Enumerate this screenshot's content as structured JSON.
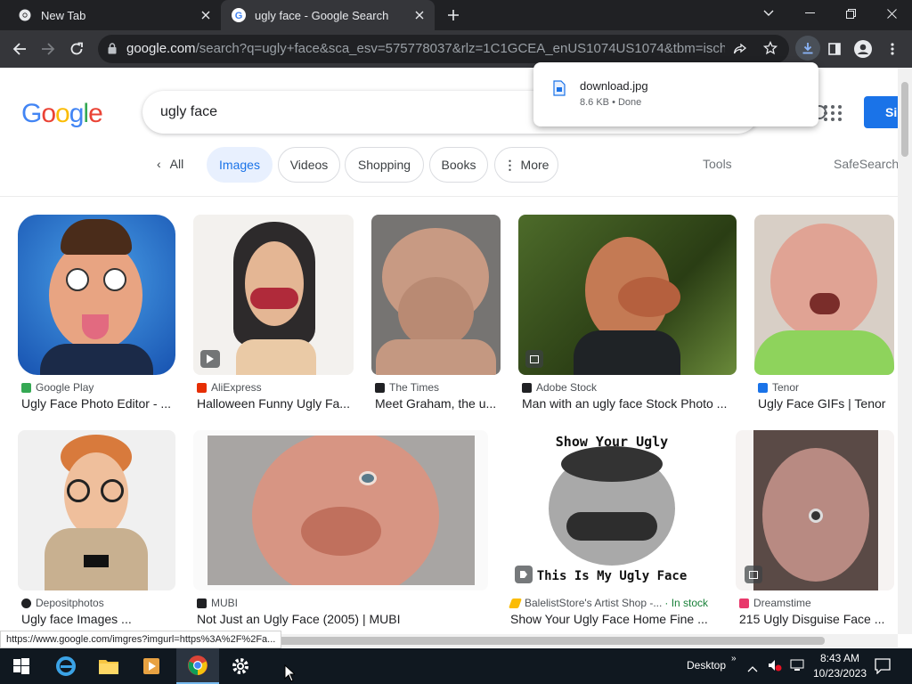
{
  "browser": {
    "tabs": [
      {
        "title": "New Tab"
      },
      {
        "title": "ugly face - Google Search"
      }
    ],
    "url_domain": "google.com",
    "url_rest": "/search?q=ugly+face&sca_esv=575778037&rlz=1C1GCEA_enUS1074US1074&tbm=isch&sourc...",
    "download": {
      "filename": "download.jpg",
      "status": "8.6 KB • Done"
    },
    "status_url": "https://www.google.com/imgres?imgurl=https%3A%2F%2Fa..."
  },
  "google": {
    "logo": [
      "G",
      "o",
      "o",
      "g",
      "l",
      "e"
    ],
    "logo_colors": [
      "#4285f4",
      "#ea4335",
      "#fbbc05",
      "#4285f4",
      "#34a853",
      "#ea4335"
    ],
    "query": "ugly face",
    "signin": "Si",
    "filters": {
      "all": "All",
      "images": "Images",
      "videos": "Videos",
      "shopping": "Shopping",
      "books": "Books",
      "more": "More",
      "tools": "Tools",
      "safesearch": "SafeSearch"
    }
  },
  "results": [
    {
      "source": "Google Play",
      "caption": "Ugly Face Photo Editor - ...",
      "icon_color": "#34a853"
    },
    {
      "source": "AliExpress",
      "caption": "Halloween Funny Ugly Fa...",
      "icon_color": "#e62e04"
    },
    {
      "source": "The Times",
      "caption": "Meet Graham, the u...",
      "icon_color": "#202124"
    },
    {
      "source": "Adobe Stock",
      "caption": "Man with an ugly face Stock Photo ...",
      "icon_color": "#202124"
    },
    {
      "source": "Tenor",
      "caption": "Ugly Face GIFs | Tenor",
      "icon_color": "#1a73e8"
    },
    {
      "source": "Depositphotos",
      "caption": "Ugly face Images ...",
      "icon_color": "#202124"
    },
    {
      "source": "MUBI",
      "caption": "Not Just an Ugly Face (2005) | MUBI",
      "icon_color": "#202124"
    },
    {
      "source": "BalelistStore's Artist Shop -...",
      "stock": "· In stock",
      "caption": "Show Your Ugly Face Home Fine ...",
      "icon_color": "#fbbc05"
    },
    {
      "source": "Dreamstime",
      "caption": "215 Ugly Disguise Face ...",
      "icon_color": "#e8396b"
    }
  ],
  "poster_text": {
    "top": "Show Your Ugly Face",
    "bottom": "This Is My Ugly Face"
  },
  "taskbar": {
    "desktop": "Desktop",
    "time": "8:43 AM",
    "date": "10/23/2023"
  }
}
